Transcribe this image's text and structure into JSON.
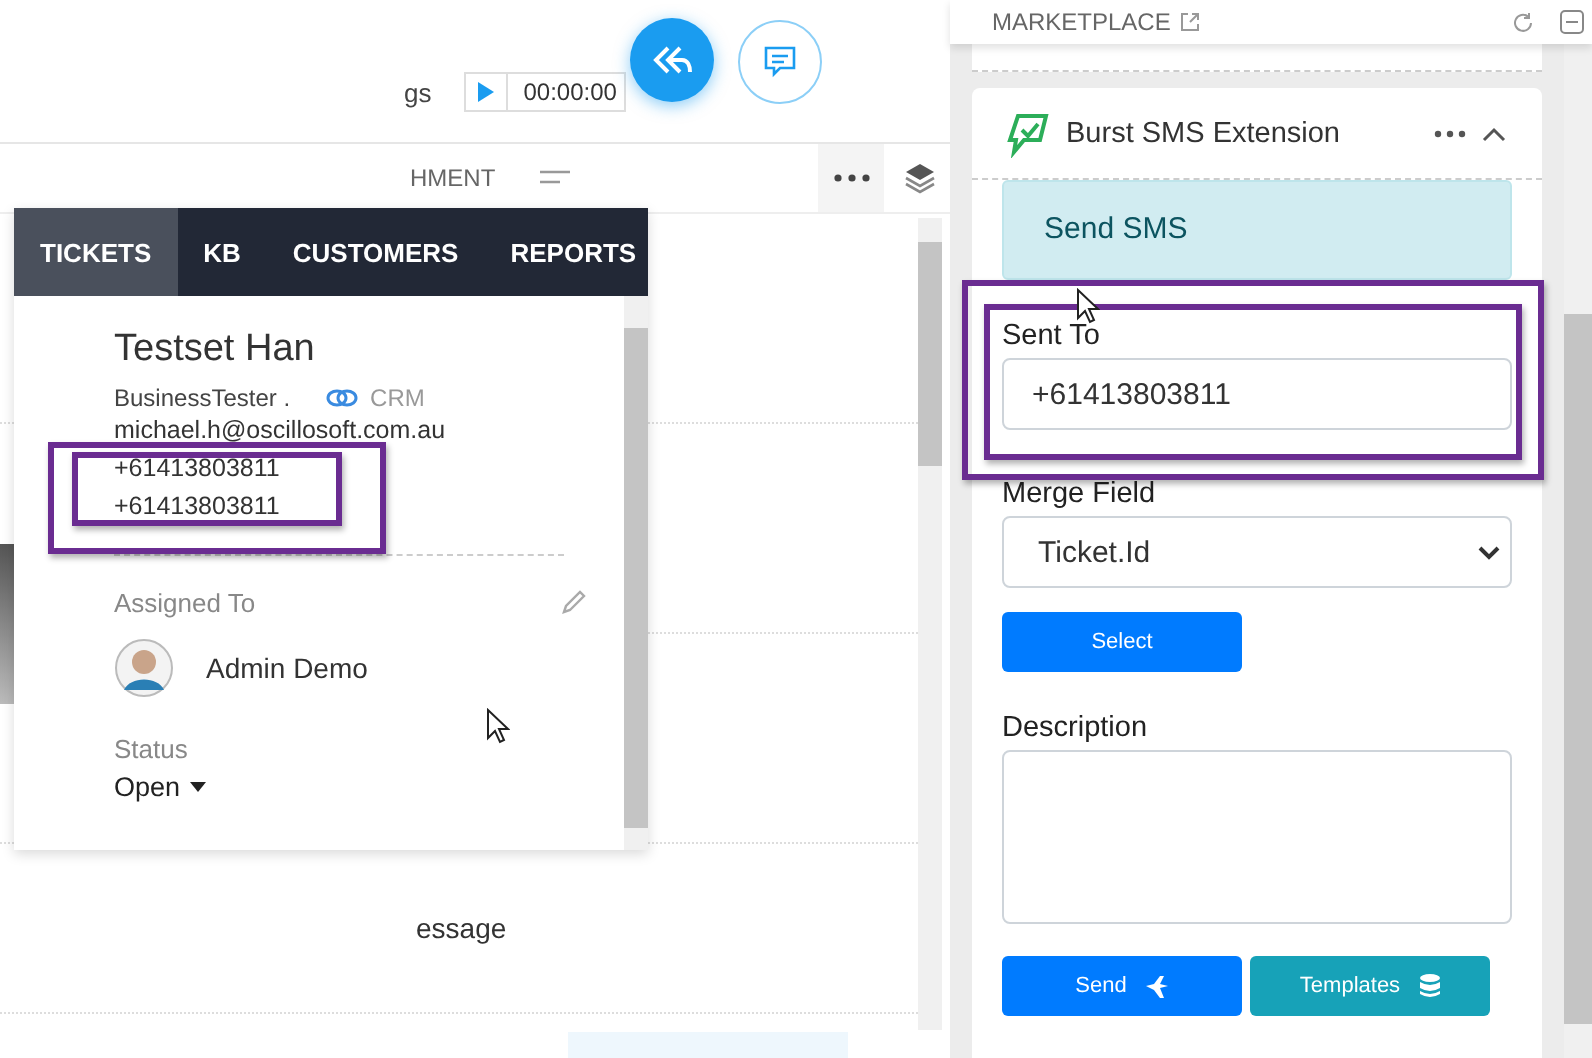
{
  "call_bar": {
    "label_fragment": "gs",
    "timer": "00:00:00"
  },
  "tab_bar": {
    "tab_fragment": "HMENT"
  },
  "message_fragment": "essage",
  "popup": {
    "tabs": [
      {
        "label": "TICKETS",
        "selected": true
      },
      {
        "label": "KB",
        "selected": false
      },
      {
        "label": "CUSTOMERS",
        "selected": false
      },
      {
        "label": "REPORTS",
        "selected": false
      }
    ],
    "contact": {
      "name": "Testset Han",
      "company": "BusinessTester .",
      "crm_label": "CRM",
      "email": "michael.h@oscillosoft.com.au",
      "phones": [
        "+61413803811",
        "+61413803811"
      ]
    },
    "assigned_label": "Assigned To",
    "assignee": "Admin Demo",
    "status_label": "Status",
    "status": "Open"
  },
  "marketplace": {
    "title": "MARKETPLACE",
    "extension": {
      "title": "Burst SMS Extension",
      "expanded": true,
      "action": "Send SMS",
      "sent_to_label": "Sent To",
      "sent_to": "+61413803811",
      "merge_label": "Merge Field",
      "merge_value": "Ticket.Id",
      "select_button": "Select",
      "description_label": "Description",
      "buttons": [
        {
          "label": "Send",
          "kind": "primary"
        },
        {
          "label": "Templates",
          "kind": "secondary"
        }
      ]
    }
  }
}
